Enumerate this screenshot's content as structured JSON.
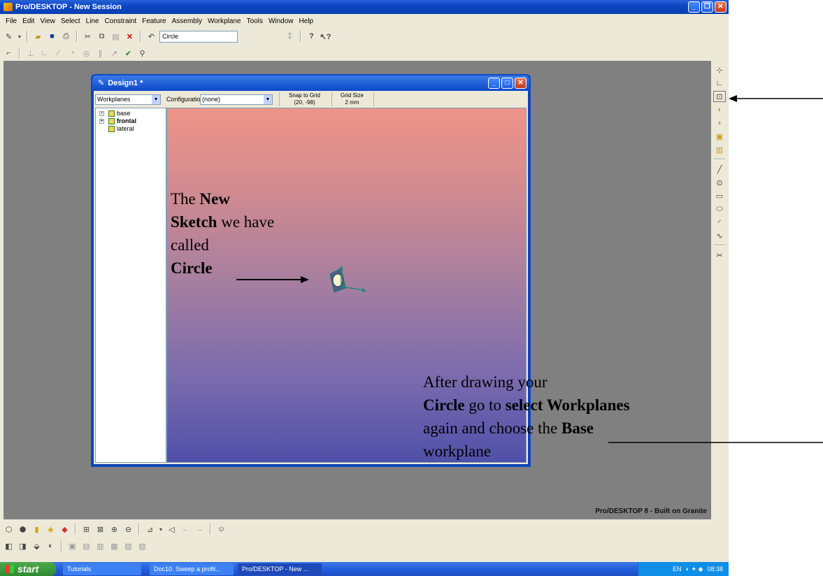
{
  "app": {
    "title": "Pro/DESKTOP - New Session",
    "brand": "Pro/DESKTOP 8 - Built on Granite"
  },
  "menu": [
    "File",
    "Edit",
    "View",
    "Select",
    "Line",
    "Constraint",
    "Feature",
    "Assembly",
    "Workplane",
    "Tools",
    "Window",
    "Help"
  ],
  "toolbar": {
    "sketch_field_value": "Circle"
  },
  "design_window": {
    "title": "Design1 *",
    "workplanes_select": "Workplanes",
    "configuration_label": "Configuration:",
    "configuration_value": "(none)",
    "snap_label": "Snap to Grid",
    "snap_value": "(20, -98)",
    "grid_label": "Grid Size",
    "grid_value": "2 mm",
    "tree": [
      {
        "label": "base",
        "expander": "+",
        "bold": false
      },
      {
        "label": "frontal",
        "expander": "+",
        "bold": true
      },
      {
        "label": "lateral",
        "expander": "",
        "bold": false
      }
    ]
  },
  "taskbar": {
    "start": "start",
    "tasks": [
      "Tutorials",
      "Doc10. Sweep a profil...",
      "Pro/DESKTOP - New ..."
    ],
    "tray_lang": "EN",
    "clock": "08:38"
  },
  "annotations": {
    "left": {
      "p1": "The ",
      "b1": "New",
      "b2": "Sketch",
      "p2": " we have called",
      "b3": "Circle"
    },
    "right": {
      "p1": "After drawing your ",
      "b1": "Circle",
      "p2": " go to ",
      "b2": "select Workplanes",
      "p3": " again and choose the ",
      "b3": "Base",
      "p4": " workplane"
    }
  },
  "colors": {
    "viewport_top": "#ee9488",
    "viewport_bottom": "#5050a8",
    "xp_blue": "#0b46c4"
  }
}
